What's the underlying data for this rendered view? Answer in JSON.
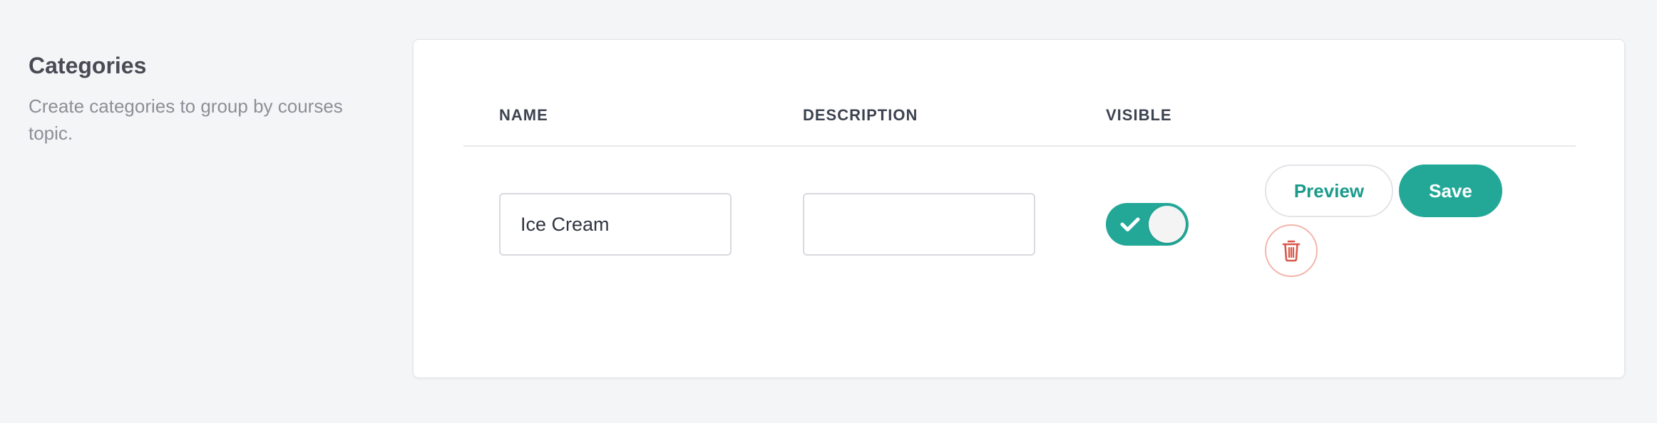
{
  "section": {
    "title": "Categories",
    "description": "Create categories to group by courses topic."
  },
  "table": {
    "headers": {
      "name": "NAME",
      "description": "DESCRIPTION",
      "visible": "VISIBLE"
    },
    "row": {
      "name_value": "Ice Cream",
      "description_value": "",
      "visible": true
    }
  },
  "actions": {
    "preview_label": "Preview",
    "save_label": "Save",
    "delete_icon": "trash-icon"
  },
  "colors": {
    "accent": "#23a898",
    "danger": "#d9584a",
    "background": "#f4f5f7"
  }
}
